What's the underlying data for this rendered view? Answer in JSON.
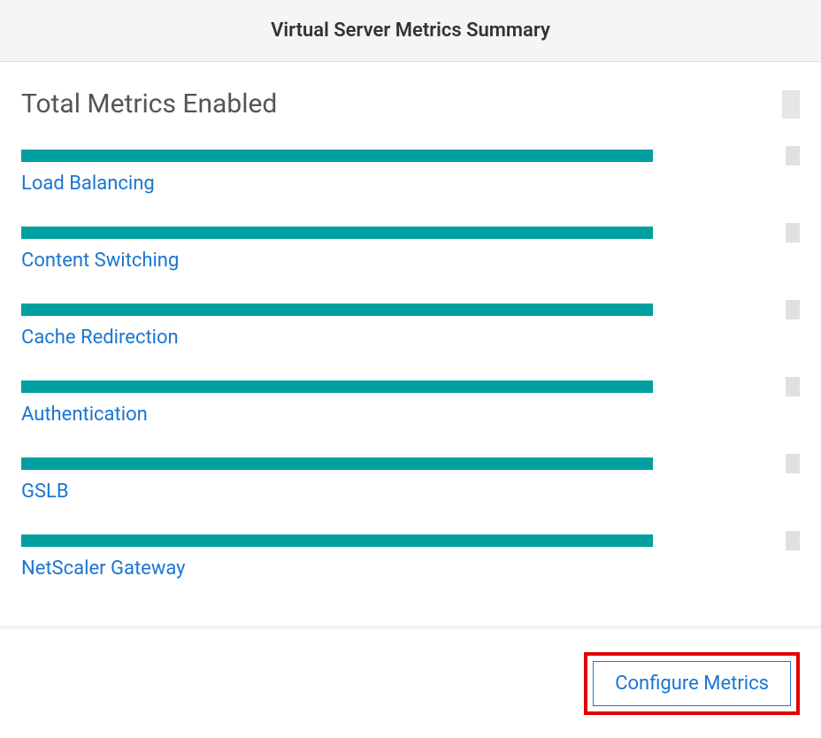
{
  "header": {
    "title": "Virtual Server Metrics Summary"
  },
  "total": {
    "label": "Total Metrics Enabled"
  },
  "metrics": [
    {
      "label": "Load Balancing"
    },
    {
      "label": "Content Switching"
    },
    {
      "label": "Cache Redirection"
    },
    {
      "label": "Authentication"
    },
    {
      "label": "GSLB"
    },
    {
      "label": "NetScaler Gateway"
    }
  ],
  "footer": {
    "configure_label": "Configure Metrics"
  },
  "colors": {
    "bar": "#00a0a0",
    "link": "#1976d2",
    "highlight": "#e20000"
  }
}
